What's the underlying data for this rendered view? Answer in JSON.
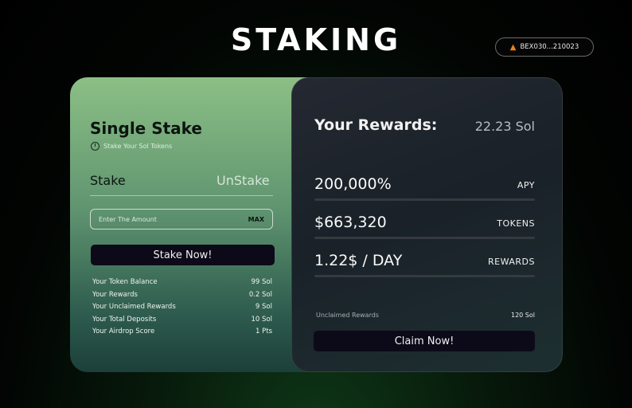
{
  "page": {
    "title": "STAKING"
  },
  "wallet": {
    "address": "BEX030...210023"
  },
  "stake_panel": {
    "title": "Single Stake",
    "subtitle": "Stake Your Sol Tokens",
    "tabs": [
      "Stake",
      "UnStake"
    ],
    "active_tab": "Stake",
    "amount_placeholder": "Enter The Amount",
    "max_label": "MAX",
    "stake_button": "Stake Now!",
    "stats": [
      {
        "label": "Your Token Balance",
        "value": "99 Sol"
      },
      {
        "label": "Your Rewards",
        "value": "0.2 Sol"
      },
      {
        "label": "Your Unclaimed Rewards",
        "value": "9 Sol"
      },
      {
        "label": "Your Total Deposits",
        "value": "10 Sol"
      },
      {
        "label": "Your Airdrop Score",
        "value": "1 Pts"
      }
    ]
  },
  "rewards_panel": {
    "title": "Your Rewards:",
    "amount": "22.23 Sol",
    "metrics": [
      {
        "value": "200,000%",
        "label": "APY"
      },
      {
        "value": "$663,320",
        "label": "TOKENS"
      },
      {
        "value": "1.22$ / DAY",
        "label": "REWARDS"
      }
    ],
    "unclaimed_label": "Unclaimed Rewards",
    "unclaimed_value": "120 Sol",
    "claim_button": "Claim Now!"
  },
  "colors": {
    "accent_green": "#8cbf85",
    "button_dark": "#0c0a18",
    "panel_dark": "#1d2329"
  }
}
